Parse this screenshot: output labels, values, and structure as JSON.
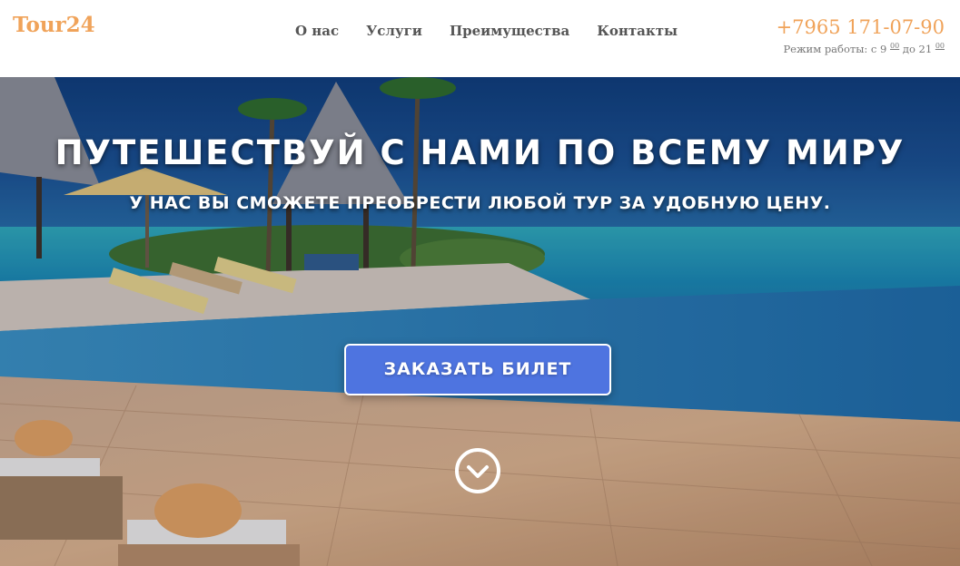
{
  "header": {
    "logo": "Tour24",
    "nav": [
      {
        "label": "О нас"
      },
      {
        "label": "Услуги"
      },
      {
        "label": "Преимущества"
      },
      {
        "label": "Контакты"
      }
    ],
    "phone": "+7965 171-07-90",
    "hours_prefix": "Режим работы: с 9",
    "hours_mid": "до 21",
    "hours_minutes": "00"
  },
  "hero": {
    "title": "ПУТЕШЕСТВУЙ С НАМИ ПО ВСЕМУ МИРУ",
    "subtitle": "У НАС ВЫ СМОЖЕТЕ ПРЕОБРЕСТИ ЛЮБОЙ ТУР ЗА УДОБНУЮ ЦЕНУ.",
    "cta_label": "ЗАКАЗАТЬ БИЛЕТ",
    "scroll_icon": "chevron-down-circle-icon"
  },
  "colors": {
    "accent": "#f0a35a",
    "button": "#4e74e0",
    "nav_text": "#555555"
  }
}
